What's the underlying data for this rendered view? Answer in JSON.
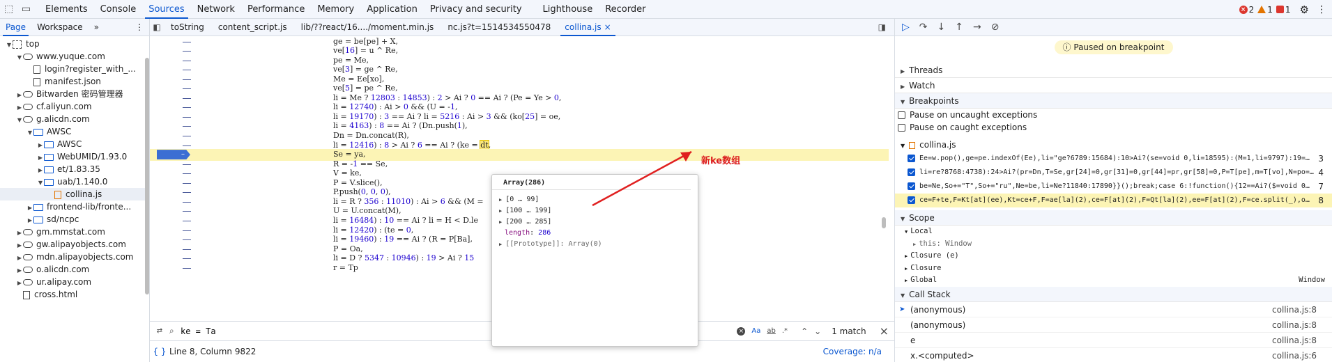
{
  "topbar": {
    "tabs": [
      "Elements",
      "Console",
      "Sources",
      "Network",
      "Performance",
      "Memory",
      "Application",
      "Privacy and security",
      "Lighthouse",
      "Recorder"
    ],
    "active": "Sources",
    "errors": "2",
    "warnings": "1",
    "issues": "1"
  },
  "navigator": {
    "tabs": [
      "Page",
      "Workspace"
    ],
    "more": "»",
    "tree": [
      {
        "label": "top",
        "depth": 0,
        "type": "frame",
        "arrow": "down"
      },
      {
        "label": "www.yuque.com",
        "depth": 1,
        "type": "cloud",
        "arrow": "down"
      },
      {
        "label": "login?register_with_...",
        "depth": 2,
        "type": "file",
        "arrow": ""
      },
      {
        "label": "manifest.json",
        "depth": 2,
        "type": "file",
        "arrow": ""
      },
      {
        "label": "Bitwarden 密码管理器",
        "depth": 1,
        "type": "cloud",
        "arrow": "right"
      },
      {
        "label": "cf.aliyun.com",
        "depth": 1,
        "type": "cloud",
        "arrow": "right"
      },
      {
        "label": "g.alicdn.com",
        "depth": 1,
        "type": "cloud",
        "arrow": "down"
      },
      {
        "label": "AWSC",
        "depth": 2,
        "type": "folder",
        "arrow": "down"
      },
      {
        "label": "AWSC",
        "depth": 3,
        "type": "folder",
        "arrow": "right"
      },
      {
        "label": "WebUMID/1.93.0",
        "depth": 3,
        "type": "folder",
        "arrow": "right"
      },
      {
        "label": "et/1.83.35",
        "depth": 3,
        "type": "folder",
        "arrow": "right"
      },
      {
        "label": "uab/1.140.0",
        "depth": 3,
        "type": "folder",
        "arrow": "down"
      },
      {
        "label": "collina.js",
        "depth": 4,
        "type": "js",
        "arrow": "",
        "selected": true
      },
      {
        "label": "frontend-lib/fronte...",
        "depth": 2,
        "type": "folder",
        "arrow": "right"
      },
      {
        "label": "sd/ncpc",
        "depth": 2,
        "type": "folder",
        "arrow": "right"
      },
      {
        "label": "gm.mmstat.com",
        "depth": 1,
        "type": "cloud",
        "arrow": "right"
      },
      {
        "label": "gw.alipayobjects.com",
        "depth": 1,
        "type": "cloud",
        "arrow": "right"
      },
      {
        "label": "mdn.alipayobjects.com",
        "depth": 1,
        "type": "cloud",
        "arrow": "right"
      },
      {
        "label": "o.alicdn.com",
        "depth": 1,
        "type": "cloud",
        "arrow": "right"
      },
      {
        "label": "ur.alipay.com",
        "depth": 1,
        "type": "cloud",
        "arrow": "right"
      },
      {
        "label": "cross.html",
        "depth": 1,
        "type": "file",
        "arrow": ""
      }
    ]
  },
  "editor": {
    "tabs": [
      "toString",
      "content_script.js",
      "lib/??react/16..../moment.min.js",
      "nc.js?t=1514534550478",
      "collina.js"
    ],
    "active": "collina.js",
    "close": "×",
    "lines": [
      "ge = be[pe] + X,",
      "ve[16] = u ^ Re,",
      "pe = Me,",
      "ve[3] = ge ^ Re,",
      "Me = Ee[xo],",
      "ve[5] = pe ^ Re,",
      "li = Me ? 12803 : 14853) : 2 > Ai ? 0 == Ai ? (Pe = Ye > 0,",
      "li = 12740) : Ai > 0 && (U = -1,",
      "li = 19170) : 3 == Ai ? li = 5216 : Ai > 3 && (ko[25] = oe,",
      "li = 4163) : 8 == Ai ? (Dn.push(1),",
      "Dn = Dn.concat(R),",
      "li = 12416) : 8 > Ai ? 6 == Ai ? (ke = dt,",
      "Se = ya,",
      "R = -1 == Se,",
      "V = ke,",
      "P = V.slice(),",
      "P.push(0, 0, 0),",
      "li = R ? 356 : 11010) : Ai > 6 && (M =",
      "U = U.concat(M),",
      "li = 16484) : 10 == Ai ? li = H < D.le",
      "li = 12420) : (te = 0,",
      "li = 19460) : 19 == Ai ? (R = P[Ba],",
      "P = Oa,",
      "li = D ? 5347 : 10946) : 19 > Ai ? 15",
      "r = Tp"
    ],
    "current_line_index": 12,
    "breakpoint_marker": "–",
    "search": {
      "value": "ke = Ta",
      "matches": "1 match",
      "case": "Aa",
      "word": "ab",
      "regex": ".*"
    },
    "status": {
      "position": "Line 8, Column 9822",
      "coverage": "Coverage: n/a"
    }
  },
  "popover": {
    "title": "Array(286)",
    "items": [
      "[0 … 99]",
      "[100 … 199]",
      "[200 … 285]"
    ],
    "length_key": "length",
    "length_val": "286",
    "proto": "[[Prototype]]: Array(0)"
  },
  "annotation": "新ke数组",
  "debugger": {
    "paused": "Paused on breakpoint",
    "sections": {
      "threads": "Threads",
      "watch": "Watch",
      "breakpoints": "Breakpoints",
      "scope": "Scope",
      "callstack": "Call Stack"
    },
    "pause_uncaught": "Pause on uncaught exceptions",
    "pause_caught": "Pause on caught exceptions",
    "bp_file": "collina.js",
    "bps": [
      {
        "code": "Ee=w.pop(),ge=pe.indexOf(Ee),li=\"ge?6789:15684):10>Ai?(se=void 0,li=18595):(M=1,li=9797):19=…",
        "line": "3"
      },
      {
        "code": "li=re?8768:4738):24>Ai?(pr=Dn,T=Se,gr[24]=0,gr[31]=0,gr[44]=pr,gr[58]=0,P=T[pe],m=T[vo],N=po=…",
        "line": "4"
      },
      {
        "code": "be=Ne,So+=\"T\",So+=\"ru\",Ne=be,li=Ne?11840:17890}}();break;case 6:!function(){12==Ai?($=void 0…",
        "line": "7"
      },
      {
        "code": "ce=F+te,F=Kt[at](ee),Kt=ce+F,F=ae[la](2),ce=F[at](2),F=Qt[la](2),ee=F[at](2),F=ce.split(_),o…",
        "line": "8",
        "hl": true
      }
    ],
    "scope": {
      "local": "Local",
      "this": "this: Window",
      "closure1": "Closure (e)",
      "closure2": "Closure",
      "global": "Global",
      "global_val": "Window"
    },
    "stack": [
      {
        "fn": "(anonymous)",
        "loc": "collina.js:8",
        "current": true
      },
      {
        "fn": "(anonymous)",
        "loc": "collina.js:8"
      },
      {
        "fn": "e",
        "loc": "collina.js:8"
      },
      {
        "fn": "x.<computed>",
        "loc": "collina.js:6"
      }
    ]
  }
}
